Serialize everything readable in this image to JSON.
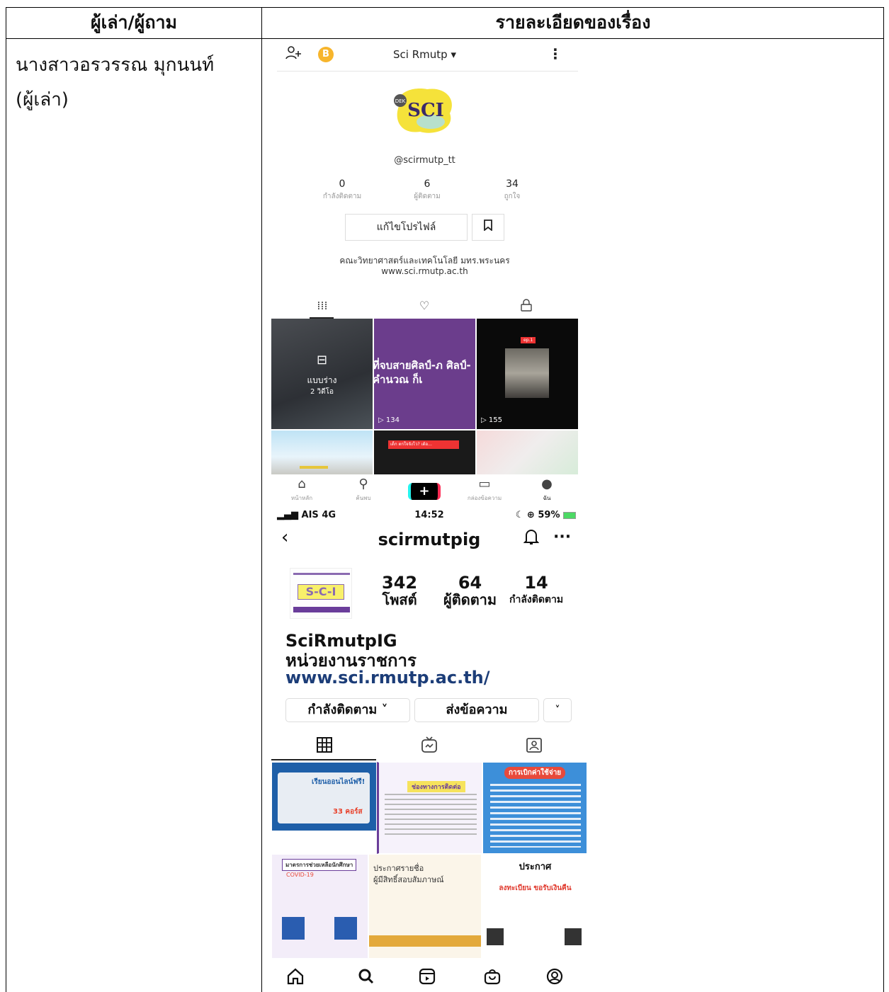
{
  "table": {
    "header_left": "ผู้เล่า/ผู้ถาม",
    "header_right": "รายละเอียดของเรื่อง",
    "narrator_name": "นางสาวอรวรรณ มุกนนท์",
    "narrator_role": "(ผู้เล่า)"
  },
  "tiktok": {
    "username": "Sci Rmutp",
    "avatar_text": "SCI",
    "avatar_badge": "DEK",
    "handle": "@scirmutp_tt",
    "stats": [
      {
        "value": "0",
        "label": "กำลังติดตาม"
      },
      {
        "value": "6",
        "label": "ผู้ติดตาม"
      },
      {
        "value": "34",
        "label": "ถูกใจ"
      }
    ],
    "edit_profile_label": "แก้ไขโปรไฟล์",
    "bio_line1": "คณะวิทยาศาสตร์และเทคโนโลยี มทร.พระนคร",
    "bio_line2": "www.sci.rmutp.ac.th",
    "drafts_label": "แบบร่าง",
    "drafts_count": "2 วิดีโอ",
    "video2_caption": "ที่จบสายศิลป์-ภ ศิลป์-คำนวณ ก็เ",
    "video2_views": "▷ 134",
    "video3_tag": "ep.1",
    "video3_views": "▷ 155",
    "video5_caption": "เด็ก ตกใจจังโว? เด้อ...",
    "nav": [
      {
        "icon": "home-icon",
        "label": "หน้าหลัก"
      },
      {
        "icon": "search-icon",
        "label": "ค้นพบ"
      },
      {
        "icon": "plus-icon",
        "label": ""
      },
      {
        "icon": "inbox-icon",
        "label": "กล่องข้อความ"
      },
      {
        "icon": "profile-icon",
        "label": "ฉัน"
      }
    ]
  },
  "instagram": {
    "carrier": "AIS 4G",
    "time": "14:52",
    "battery": "☾ ⊕ 59%",
    "username": "scirmutpig",
    "avatar_text": "S-C-I",
    "posts_count": "342",
    "posts_label": "โพสต์",
    "followers_count": "64",
    "followers_label": "ผู้ติดตาม",
    "following_count": "14",
    "following_label": "กำลังติดตาม",
    "display_name": "SciRmutpIG",
    "category": "หน่วยงานราชการ",
    "link": "www.sci.rmutp.ac.th/",
    "following_btn": "กำลังติดตาม ˅",
    "message_btn": "ส่งข้อความ",
    "more_btn": "˅",
    "posts": [
      {
        "title": "เรียนออนไลน์ฟรี!",
        "sub": "33 คอร์ส",
        "bg": "#1e5fa8"
      },
      {
        "title": "ช่องทางการติดต่อ",
        "sub": "",
        "bg": "#f6f2fb"
      },
      {
        "title": "การเบิกค่าใช้จ่าย",
        "sub": "",
        "bg": "#3d8fd9"
      },
      {
        "title": "มาตรการช่วยเหลือนักศึกษา",
        "sub": "COVID-19",
        "bg": "#f3edf9"
      },
      {
        "title": "ประกาศรายชื่อ",
        "sub": "ผู้มีสิทธิ์สอบสัมภาษณ์",
        "bg": "#fbf5e9"
      },
      {
        "title": "ประกาศ",
        "sub": "ลงทะเบียน ขอรับเงินคืน",
        "bg": "#ffffff"
      }
    ]
  }
}
